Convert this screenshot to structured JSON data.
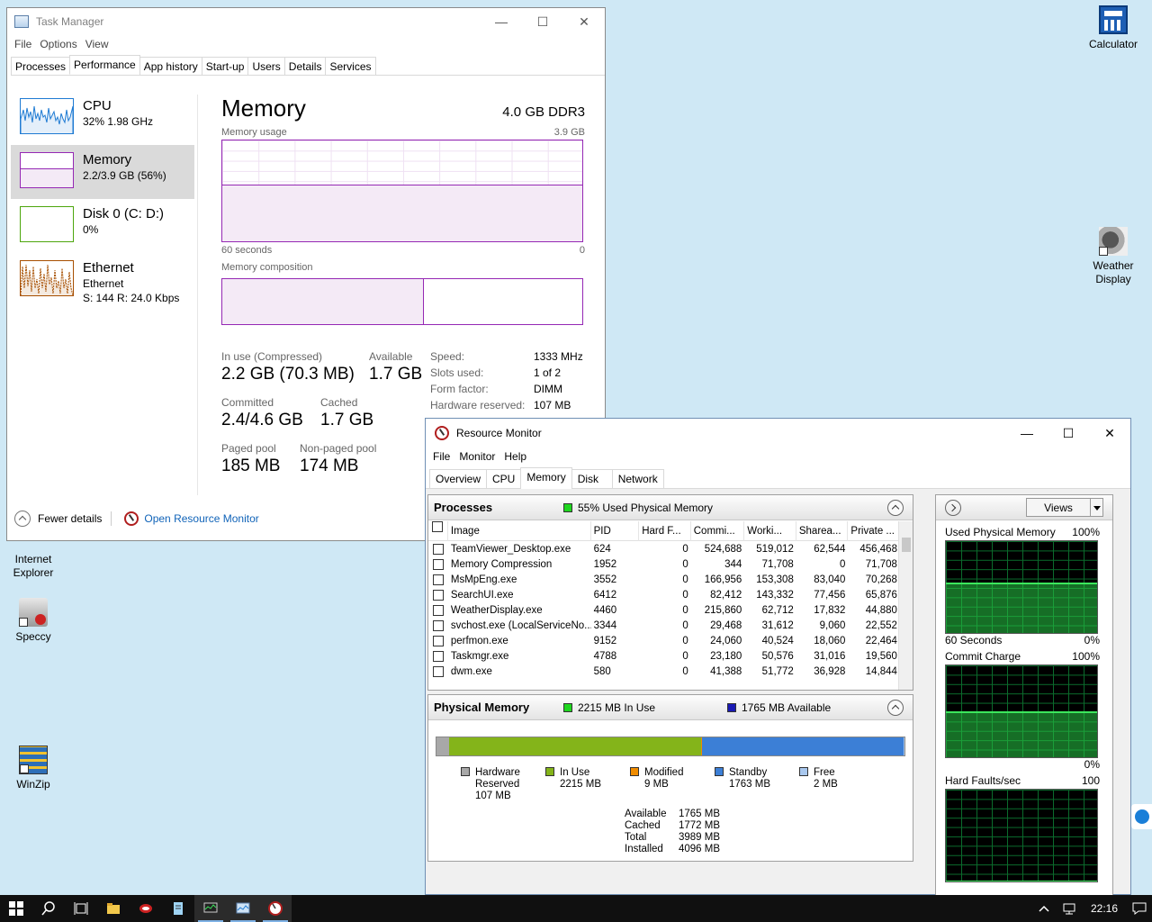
{
  "desktop": {
    "icons": [
      {
        "label": "Calculator"
      },
      {
        "label": "Weather Display"
      },
      {
        "label": "Internet Explorer"
      },
      {
        "label": "Speccy"
      },
      {
        "label": "WinZip"
      }
    ]
  },
  "task_manager": {
    "title": "Task Manager",
    "menu": [
      "File",
      "Options",
      "View"
    ],
    "tabs": [
      "Processes",
      "Performance",
      "App history",
      "Start-up",
      "Users",
      "Details",
      "Services"
    ],
    "active_tab": "Performance",
    "sidebar": [
      {
        "title": "CPU",
        "sub": "32%  1.98 GHz",
        "sub2": "",
        "color": "#1f7bd3"
      },
      {
        "title": "Memory",
        "sub": "2.2/3.9 GB (56%)",
        "sub2": "",
        "color": "#9528b4"
      },
      {
        "title": "Disk 0 (C: D:)",
        "sub": "0%",
        "sub2": "",
        "color": "#4da60c"
      },
      {
        "title": "Ethernet",
        "sub": "Ethernet",
        "sub2": "S: 144  R: 24.0 Kbps",
        "color": "#a74f01"
      }
    ],
    "memory": {
      "title": "Memory",
      "type": "4.0 GB DDR3",
      "usage_label": "Memory usage",
      "usage_max": "3.9 GB",
      "usage_fraction": 0.56,
      "time_left": "60 seconds",
      "time_right": "0",
      "composition_label": "Memory composition",
      "composition_in_use_fraction": 0.56,
      "stats": {
        "in_use_label": "In use (Compressed)",
        "in_use": "2.2 GB (70.3 MB)",
        "available_label": "Available",
        "available": "1.7 GB",
        "committed_label": "Committed",
        "committed": "2.4/4.6 GB",
        "cached_label": "Cached",
        "cached": "1.7 GB",
        "paged_label": "Paged pool",
        "paged": "185 MB",
        "nonpaged_label": "Non-paged pool",
        "nonpaged": "174 MB"
      },
      "specs": [
        {
          "k": "Speed:",
          "v": "1333 MHz"
        },
        {
          "k": "Slots used:",
          "v": "1 of 2"
        },
        {
          "k": "Form factor:",
          "v": "DIMM"
        },
        {
          "k": "Hardware reserved:",
          "v": "107 MB"
        }
      ]
    },
    "footer": {
      "fewer": "Fewer details",
      "open_rm": "Open Resource Monitor"
    }
  },
  "resource_monitor": {
    "title": "Resource Monitor",
    "menu": [
      "File",
      "Monitor",
      "Help"
    ],
    "tabs": [
      "Overview",
      "CPU",
      "Memory",
      "Disk",
      "Network"
    ],
    "active_tab": "Memory",
    "processes": {
      "header": "Processes",
      "status": "55% Used Physical Memory",
      "status_color": "#1fd61f",
      "columns": [
        "Image",
        "PID",
        "Hard F...",
        "Commi...",
        "Worki...",
        "Sharea...",
        "Private ..."
      ],
      "rows": [
        [
          "TeamViewer_Desktop.exe",
          "624",
          "0",
          "524,688",
          "519,012",
          "62,544",
          "456,468"
        ],
        [
          "Memory Compression",
          "1952",
          "0",
          "344",
          "71,708",
          "0",
          "71,708"
        ],
        [
          "MsMpEng.exe",
          "3552",
          "0",
          "166,956",
          "153,308",
          "83,040",
          "70,268"
        ],
        [
          "SearchUI.exe",
          "6412",
          "0",
          "82,412",
          "143,332",
          "77,456",
          "65,876"
        ],
        [
          "WeatherDisplay.exe",
          "4460",
          "0",
          "215,860",
          "62,712",
          "17,832",
          "44,880"
        ],
        [
          "svchost.exe (LocalServiceNo...",
          "3344",
          "0",
          "29,468",
          "31,612",
          "9,060",
          "22,552"
        ],
        [
          "perfmon.exe",
          "9152",
          "0",
          "24,060",
          "40,524",
          "18,060",
          "22,464"
        ],
        [
          "Taskmgr.exe",
          "4788",
          "0",
          "23,180",
          "50,576",
          "31,016",
          "19,560"
        ],
        [
          "dwm.exe",
          "580",
          "0",
          "41,388",
          "51,772",
          "36,928",
          "14,844"
        ]
      ]
    },
    "physical": {
      "header": "Physical Memory",
      "in_use_status": "2215 MB In Use",
      "available_status": "1765 MB Available",
      "bar": [
        {
          "name": "Hardware Reserved",
          "mb": 107,
          "color": "#a8a8a8"
        },
        {
          "name": "In Use",
          "mb": 2215,
          "color": "#84b41a"
        },
        {
          "name": "Modified",
          "mb": 9,
          "color": "#f08c00"
        },
        {
          "name": "Standby",
          "mb": 1763,
          "color": "#3c7fd6"
        },
        {
          "name": "Free",
          "mb": 2,
          "color": "#a9c8ee"
        }
      ],
      "legend": [
        {
          "l1": "Hardware",
          "l2": "Reserved",
          "l3": "107 MB"
        },
        {
          "l1": "In Use",
          "l2": "2215 MB",
          "l3": ""
        },
        {
          "l1": "Modified",
          "l2": "9 MB",
          "l3": ""
        },
        {
          "l1": "Standby",
          "l2": "1763 MB",
          "l3": ""
        },
        {
          "l1": "Free",
          "l2": "2 MB",
          "l3": ""
        }
      ],
      "totals": [
        {
          "k": "Available",
          "v": "1765 MB"
        },
        {
          "k": "Cached",
          "v": "1772 MB"
        },
        {
          "k": "Total",
          "v": "3989 MB"
        },
        {
          "k": "Installed",
          "v": "4096 MB"
        }
      ]
    },
    "side": {
      "views": "Views",
      "graphs": [
        {
          "title": "Used Physical Memory",
          "max": "100%",
          "foot_left": "60 Seconds",
          "foot_right": "0%",
          "level": 0.55
        },
        {
          "title": "Commit Charge",
          "max": "100%",
          "foot_left": "",
          "foot_right": "0%",
          "level": 0.5
        },
        {
          "title": "Hard Faults/sec",
          "max": "100",
          "foot_left": "",
          "foot_right": "",
          "level": 0.0
        }
      ]
    }
  },
  "taskbar": {
    "clock": "22:16"
  }
}
